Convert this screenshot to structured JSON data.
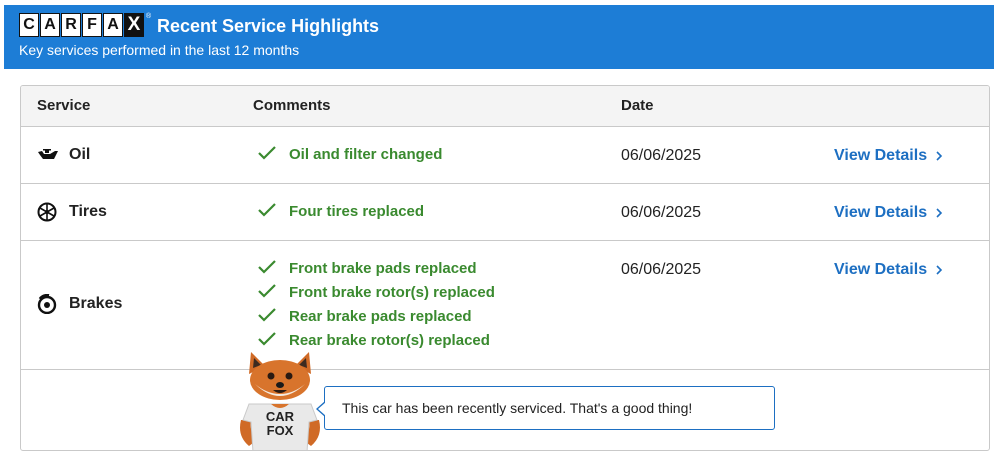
{
  "header": {
    "logo_letters": [
      "C",
      "A",
      "R",
      "F",
      "A",
      "X"
    ],
    "logo_reg": "®",
    "title": "Recent Service Highlights",
    "subtitle": "Key services performed in the last 12 months",
    "background_color": "#1d7dd6"
  },
  "table": {
    "columns": [
      "Service",
      "Comments",
      "Date"
    ],
    "rows": [
      {
        "service": "Oil",
        "icon": "oil-can-icon",
        "comments": [
          "Oil and filter changed"
        ],
        "date": "06/06/2025",
        "link": "View Details"
      },
      {
        "service": "Tires",
        "icon": "tire-icon",
        "comments": [
          "Four tires replaced"
        ],
        "date": "06/06/2025",
        "link": "View Details"
      },
      {
        "service": "Brakes",
        "icon": "brake-disc-icon",
        "comments": [
          "Front brake pads replaced",
          "Front brake rotor(s) replaced",
          "Rear brake pads replaced",
          "Rear brake rotor(s) replaced"
        ],
        "date": "06/06/2025",
        "link": "View Details"
      }
    ]
  },
  "mascot": {
    "shirt_line1": "CAR",
    "shirt_line2": "FOX",
    "message": "This car has been recently serviced. That's a good thing!"
  },
  "colors": {
    "accent": "#1d7dd6",
    "link": "#1d6fc2",
    "check_green": "#3a8a2f"
  }
}
